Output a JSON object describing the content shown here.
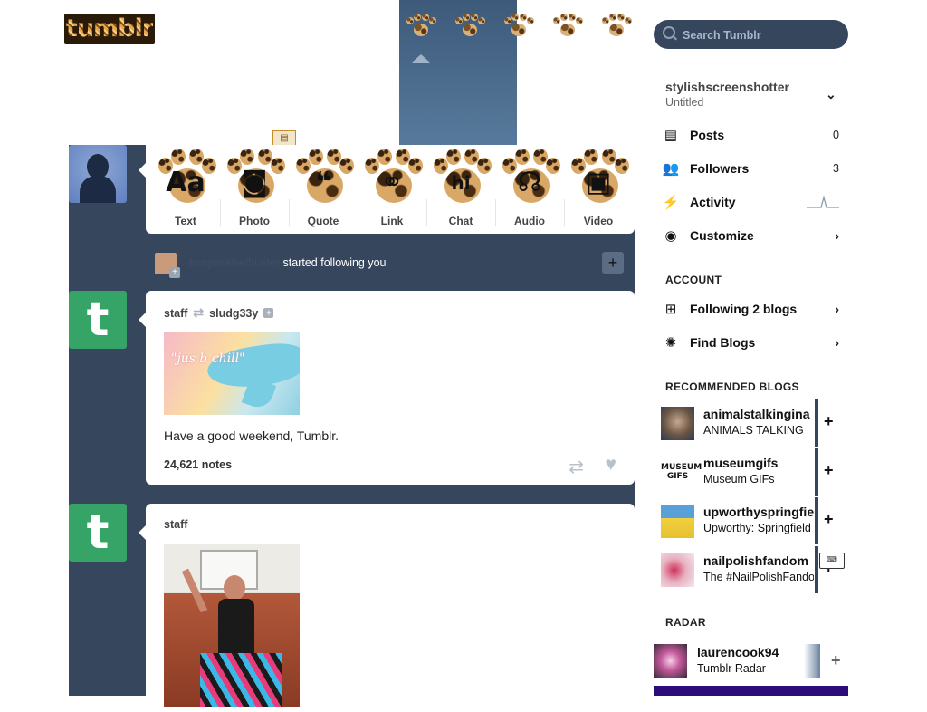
{
  "logo": {
    "text": "tumblr"
  },
  "nav": {
    "icons": [
      "home-paw-icon",
      "explore-paw-icon",
      "inbox-paw-icon",
      "messages-paw-icon",
      "account-paw-icon"
    ]
  },
  "post_types": [
    {
      "label": "Text",
      "glyph": "Aa"
    },
    {
      "label": "Photo",
      "glyph": "◙"
    },
    {
      "label": "Quote",
      "glyph": "❝"
    },
    {
      "label": "Link",
      "glyph": "⚭"
    },
    {
      "label": "Chat",
      "glyph": "hi"
    },
    {
      "label": "Audio",
      "glyph": "☊"
    },
    {
      "label": "Video",
      "glyph": "▣"
    }
  ],
  "activity": {
    "user": "tomparalsetbuster",
    "action": "started following you",
    "follow_button": "+"
  },
  "posts": [
    {
      "author": "staff",
      "reblogged_from": "sludg33y",
      "image_caption": "\"jus b chill\"",
      "text": "Have a good weekend, Tumblr.",
      "notes": "24,621 notes"
    },
    {
      "author": "staff"
    }
  ],
  "search": {
    "placeholder": "Search Tumblr"
  },
  "account": {
    "blog_name": "stylishscreenshotter",
    "blog_title": "Untitled",
    "menu": [
      {
        "label": "Posts",
        "count": "0",
        "icon": "posts-icon"
      },
      {
        "label": "Followers",
        "count": "3",
        "icon": "followers-icon"
      },
      {
        "label": "Activity",
        "count": "",
        "icon": "activity-icon"
      },
      {
        "label": "Customize",
        "count": "",
        "icon": "customize-eye-icon"
      }
    ]
  },
  "account_section": {
    "heading": "ACCOUNT",
    "items": [
      {
        "label": "Following 2 blogs",
        "icon": "following-icon"
      },
      {
        "label": "Find Blogs",
        "icon": "find-blogs-icon"
      }
    ]
  },
  "recommended": {
    "heading": "RECOMMENDED BLOGS",
    "blogs": [
      {
        "name": "animalstalkingina",
        "title": "ANIMALS TALKING"
      },
      {
        "name": "museumgifs",
        "title": "Museum GIFs",
        "avatar_text": "MUSEUM GIFS"
      },
      {
        "name": "upworthyspringfie",
        "title": "Upworthy: Springfield"
      },
      {
        "name": "nailpolishfandom",
        "title": "The #NailPolishFandom"
      }
    ]
  },
  "radar": {
    "heading": "RADAR",
    "name": "laurencook94",
    "source": "Tumblr Radar"
  },
  "colors": {
    "dashboard_bg": "#36465d",
    "tumblr_green": "#35a466",
    "search_bg": "#36465d"
  }
}
